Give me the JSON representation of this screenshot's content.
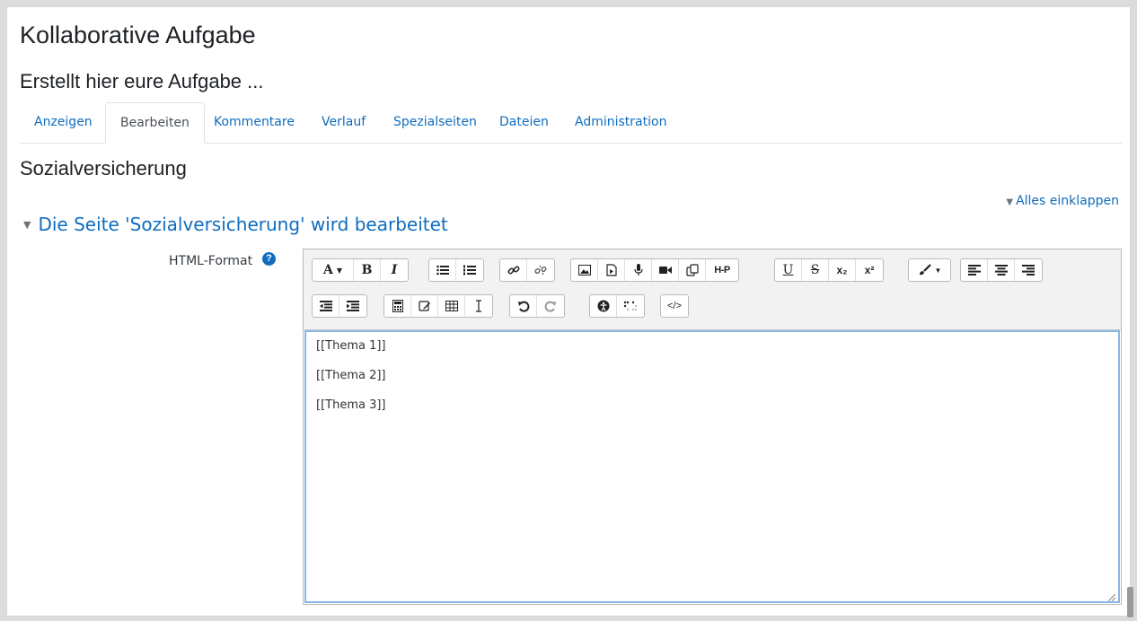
{
  "page": {
    "title": "Kollaborative Aufgabe",
    "subtitle": "Erstellt hier eure Aufgabe ...",
    "section_heading": "Sozialversicherung",
    "collapse_all": "Alles einklappen",
    "edit_heading": "Die Seite 'Sozialversicherung' wird bearbeitet"
  },
  "tabs": [
    {
      "label": "Anzeigen"
    },
    {
      "label": "Bearbeiten"
    },
    {
      "label": "Kommentare"
    },
    {
      "label": "Verlauf"
    },
    {
      "label": "Spezialseiten"
    },
    {
      "label": "Dateien"
    },
    {
      "label": "Administration"
    }
  ],
  "active_tab": "Bearbeiten",
  "form": {
    "format_label": "HTML-Format",
    "help_icon": "?"
  },
  "toolbar": {
    "font_label": "A",
    "bold_label": "B",
    "italic_label": "I",
    "hp_label": "H-P",
    "underline_label": "U",
    "strike_label": "S",
    "sub_label": "x₂",
    "sup_label": "x²",
    "html_label": "</>"
  },
  "editor": {
    "lines": [
      "[[Thema 1]]",
      "[[Thema 2]]",
      "[[Thema 3]]"
    ]
  },
  "colors": {
    "link": "#0f6cbf",
    "focus_border": "#8ab6e5"
  }
}
